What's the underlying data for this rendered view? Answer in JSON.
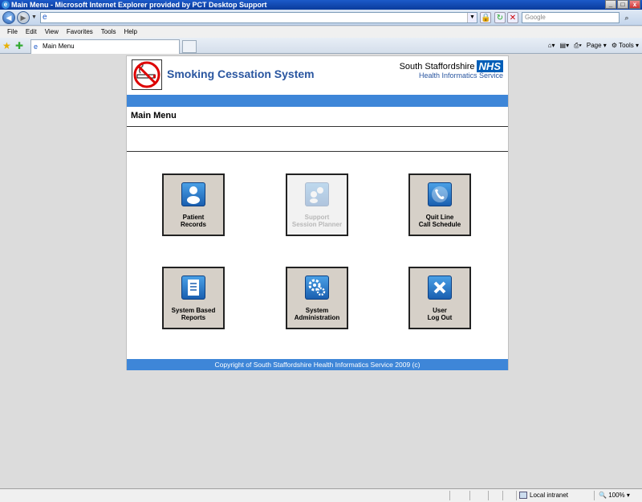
{
  "window": {
    "title": "Main Menu - Microsoft Internet Explorer provided by PCT Desktop Support"
  },
  "browser": {
    "address_value": "",
    "search_placeholder": "Google",
    "menu": [
      "File",
      "Edit",
      "View",
      "Favorites",
      "Tools",
      "Help"
    ],
    "tab_label": "Main Menu",
    "page_label": "Page",
    "tools_label": "Tools"
  },
  "app": {
    "title": "Smoking Cessation System",
    "org_line1": "South Staffordshire",
    "org_badge": "NHS",
    "org_line2": "Health Informatics Service",
    "section_title": "Main Menu",
    "tiles": [
      {
        "line1": "Patient",
        "line2": "Records",
        "icon": "person-icon",
        "enabled": true
      },
      {
        "line1": "Support",
        "line2": "Session Planner",
        "icon": "group-icon",
        "enabled": false
      },
      {
        "line1": "Quit Line",
        "line2": "Call Schedule",
        "icon": "phone-icon",
        "enabled": true
      },
      {
        "line1": "System Based",
        "line2": "Reports",
        "icon": "report-icon",
        "enabled": true
      },
      {
        "line1": "System",
        "line2": "Administration",
        "icon": "gears-icon",
        "enabled": true
      },
      {
        "line1": "User",
        "line2": "Log Out",
        "icon": "close-x-icon",
        "enabled": true
      }
    ],
    "footer": "Copyright of South Staffordshire Health Informatics Service 2009 (c)"
  },
  "status": {
    "zone": "Local intranet",
    "zoom": "100%"
  }
}
